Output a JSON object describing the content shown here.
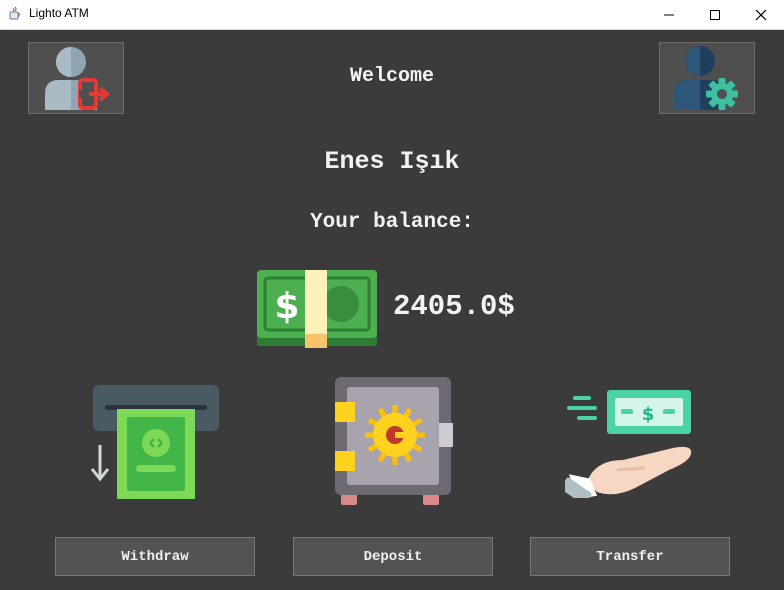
{
  "window": {
    "title": "Lighto ATM",
    "app_icon": "java-cup-icon"
  },
  "header": {
    "welcome": "Welcome",
    "logout_icon": "user-logout-icon",
    "settings_icon": "user-settings-icon"
  },
  "user": {
    "name": "Enes Işık"
  },
  "balance": {
    "label": "Your balance:",
    "amount": "2405.0$",
    "icon": "cash-bundle-icon"
  },
  "actions": [
    {
      "label": "Withdraw",
      "icon": "atm-withdraw-icon"
    },
    {
      "label": "Deposit",
      "icon": "safe-icon"
    },
    {
      "label": "Transfer",
      "icon": "hand-money-icon"
    }
  ],
  "colors": {
    "background": "#3b3b3b",
    "button": "#535353",
    "text": "#f2f2f2"
  }
}
